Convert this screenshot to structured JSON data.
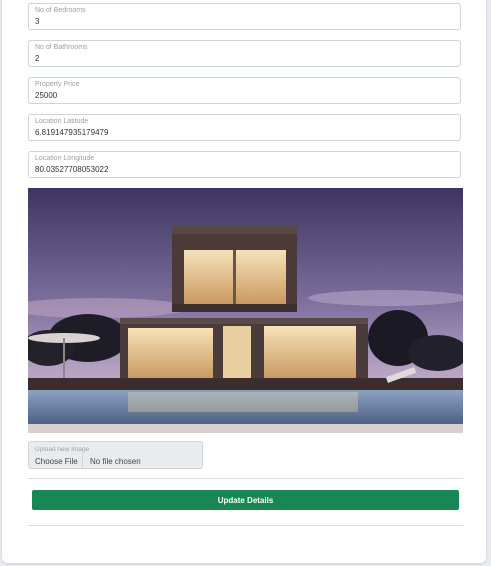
{
  "form": {
    "bedrooms": {
      "label": "No of Bedrooms",
      "value": "3"
    },
    "bathrooms": {
      "label": "No of Bathrooms",
      "value": "2"
    },
    "price": {
      "label": "Property Price",
      "value": "25000"
    },
    "latitude": {
      "label": "Location Latitude",
      "value": "6.819147935179479"
    },
    "longitude": {
      "label": "Location Longitude",
      "value": "80.03527708053022"
    }
  },
  "upload": {
    "label": "Upload new Image",
    "button": "Choose File",
    "status": "No file chosen"
  },
  "submit": {
    "label": "Update Details"
  },
  "colors": {
    "accent": "#198754",
    "border": "#ced4da"
  },
  "image": {
    "subject": "modern-house-at-dusk-with-pool"
  }
}
